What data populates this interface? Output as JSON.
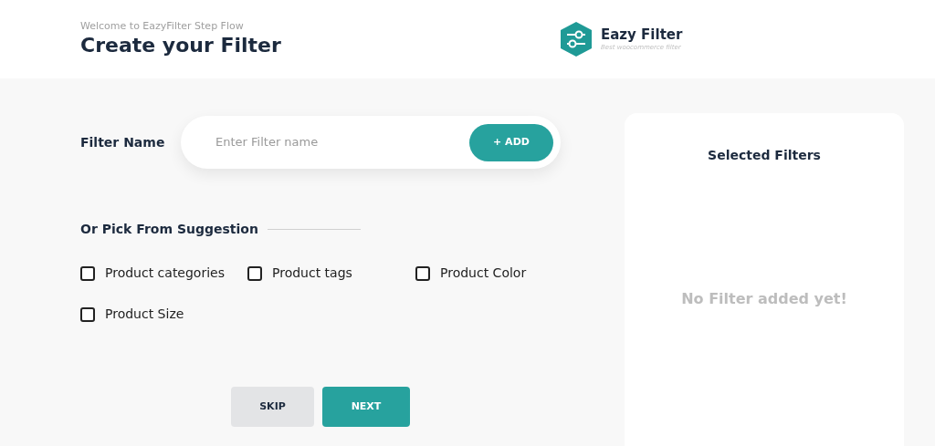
{
  "header": {
    "subtitle": "Welcome to EazyFilter Step Flow",
    "title": "Create your Filter",
    "logo": {
      "name": "Eazy Filter",
      "tagline": "Best woocommerce filter"
    }
  },
  "filter_name": {
    "label": "Filter Name",
    "placeholder": "Enter Filter name",
    "add_button": "+ ADD"
  },
  "suggestions": {
    "heading": "Or Pick From Suggestion",
    "options": [
      {
        "label": "Product categories",
        "checked": false
      },
      {
        "label": "Product tags",
        "checked": false
      },
      {
        "label": "Product Color",
        "checked": false
      },
      {
        "label": "Product Size",
        "checked": false
      }
    ]
  },
  "buttons": [
    {
      "label": "SKIP",
      "kind": "secondary"
    },
    {
      "label": "NEXT",
      "kind": "primary"
    }
  ],
  "selected_panel": {
    "title": "Selected Filters",
    "empty_text": "No Filter added yet!"
  }
}
